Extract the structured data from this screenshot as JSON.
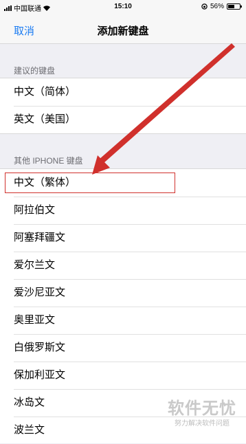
{
  "status_bar": {
    "carrier": "中国联通",
    "time": "15:10",
    "battery_percent": "56%",
    "battery_level": 0.56
  },
  "nav": {
    "cancel_label": "取消",
    "title": "添加新键盘"
  },
  "suggested": {
    "header": "建议的键盘",
    "items": [
      {
        "label": "中文（简体）"
      },
      {
        "label": "英文（美国）"
      }
    ]
  },
  "other": {
    "header": "其他 IPHONE 键盘",
    "items": [
      {
        "label": "中文（繁体）"
      },
      {
        "label": "阿拉伯文"
      },
      {
        "label": "阿塞拜疆文"
      },
      {
        "label": "爱尔兰文"
      },
      {
        "label": "爱沙尼亚文"
      },
      {
        "label": "奥里亚文"
      },
      {
        "label": "白俄罗斯文"
      },
      {
        "label": "保加利亚文"
      },
      {
        "label": "冰岛文"
      },
      {
        "label": "波兰文"
      }
    ]
  },
  "annotation": {
    "color": "#d0302c"
  },
  "watermark": {
    "main": "软件无忧",
    "sub": "努力解决软件问题"
  }
}
